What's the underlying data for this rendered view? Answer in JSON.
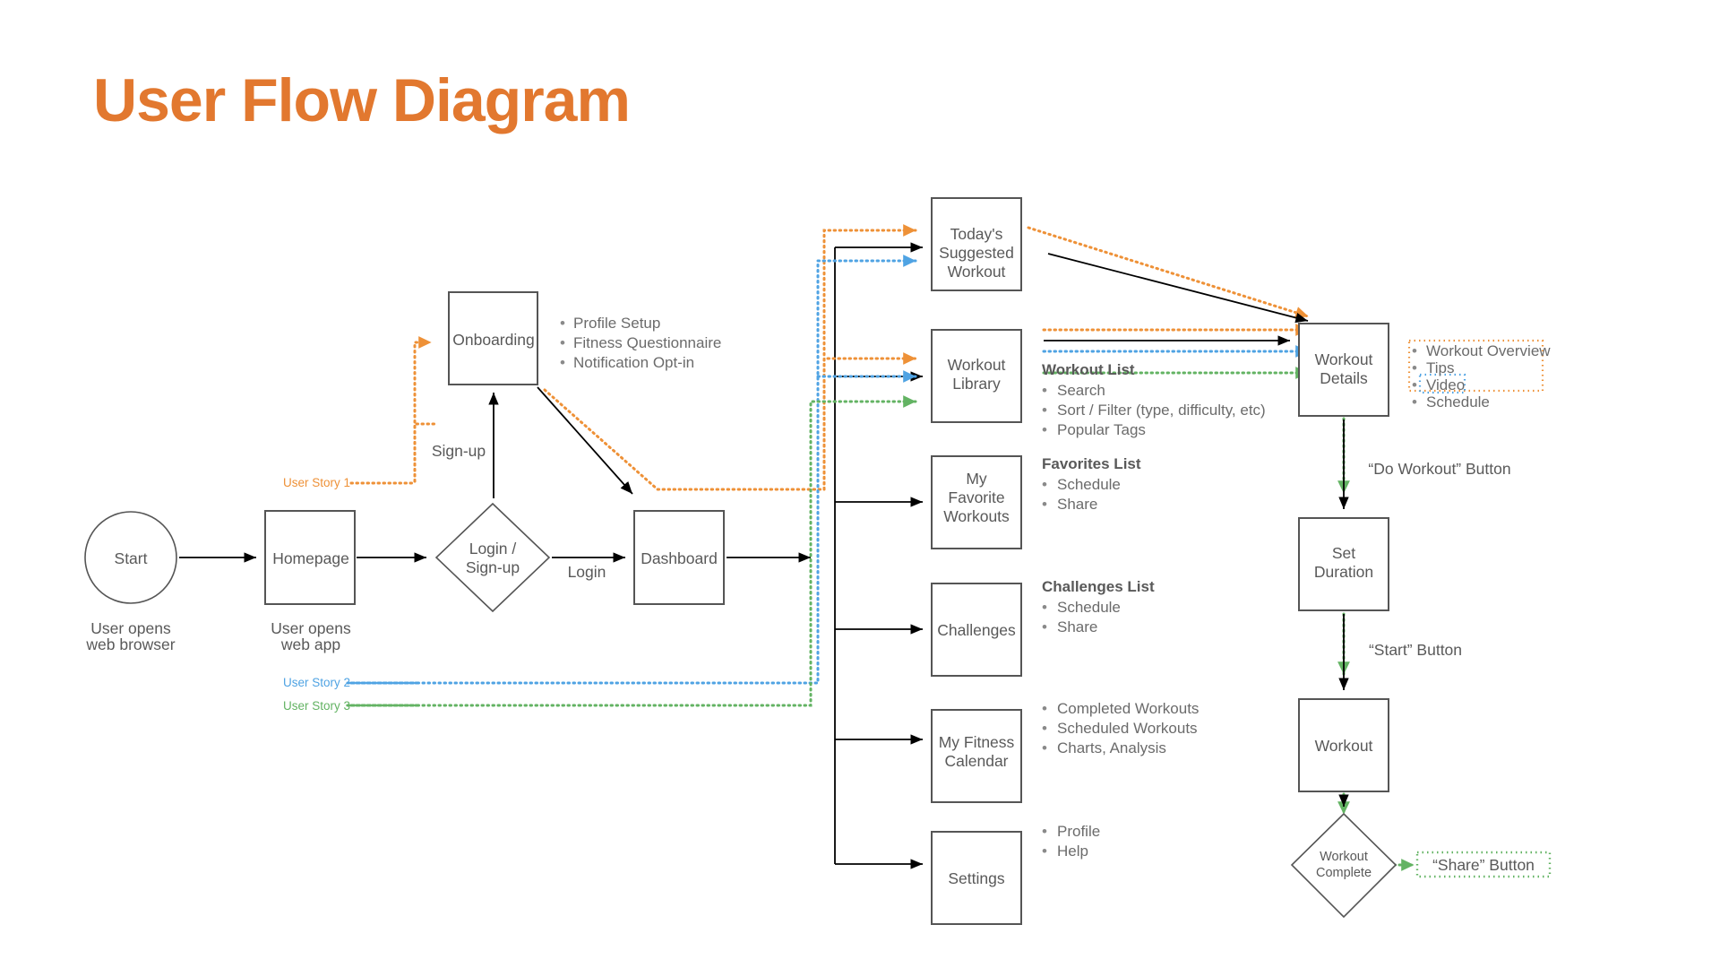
{
  "title": "User Flow Diagram",
  "colors": {
    "title": "#E2782F",
    "story1": "#EE9137",
    "story2": "#4FA3E3",
    "story3": "#63B363",
    "node_stroke": "#555555",
    "text": "#595959"
  },
  "legend": [
    {
      "label": "User Story 1",
      "color": "#EE9137"
    },
    {
      "label": "User Story 2",
      "color": "#4FA3E3"
    },
    {
      "label": "User Story 3",
      "color": "#63B363"
    }
  ],
  "nodes": {
    "start": "Start",
    "homepage": "Homepage",
    "login": [
      "Login /",
      "Sign-up"
    ],
    "onboarding": "Onboarding",
    "dashboard": "Dashboard",
    "todays": [
      "Today's",
      "Suggested",
      "Workout"
    ],
    "library": [
      "Workout",
      "Library"
    ],
    "favorites": [
      "My",
      "Favorite",
      "Workouts"
    ],
    "challenges": "Challenges",
    "calendar": [
      "My Fitness",
      "Calendar"
    ],
    "settings": "Settings",
    "details": [
      "Workout",
      "Details"
    ],
    "duration": [
      "Set",
      "Duration"
    ],
    "workout": "Workout",
    "complete": [
      "Workout",
      "Complete"
    ]
  },
  "captions": {
    "start": [
      "User opens",
      "web browser"
    ],
    "homepage": [
      "User opens",
      "web app"
    ]
  },
  "edge_labels": {
    "signup": "Sign-up",
    "login": "Login",
    "do_workout": "“Do Workout” Button",
    "start_button": "“Start” Button",
    "share_button": "“Share” Button"
  },
  "lists": {
    "onboarding": {
      "header": "",
      "items": [
        "Profile Setup",
        "Fitness Questionnaire",
        "Notification Opt-in"
      ]
    },
    "workout_list": {
      "header": "Workout List",
      "items": [
        "Search",
        "Sort / Filter (type, difficulty, etc)",
        "Popular Tags"
      ]
    },
    "favorites_list": {
      "header": "Favorites List",
      "items": [
        "Schedule",
        "Share"
      ]
    },
    "challenges_list": {
      "header": "Challenges List",
      "items": [
        "Schedule",
        "Share"
      ]
    },
    "calendar_list": {
      "header": "",
      "items": [
        "Completed Workouts",
        "Scheduled Workouts",
        "Charts, Analysis"
      ]
    },
    "settings_list": {
      "header": "",
      "items": [
        "Profile",
        "Help"
      ]
    },
    "details_list": {
      "header": "",
      "items": [
        "Workout Overview",
        "Tips",
        "Video",
        "Schedule"
      ]
    }
  }
}
